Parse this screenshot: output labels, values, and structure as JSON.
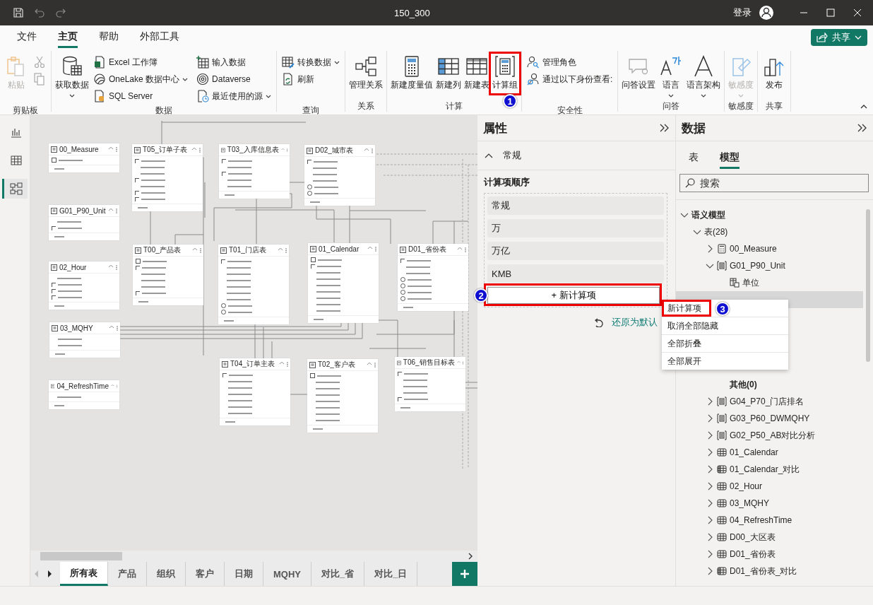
{
  "window": {
    "title": "150_300",
    "sign_in": "登录"
  },
  "menu_tabs": [
    {
      "label": "文件",
      "selected": false
    },
    {
      "label": "主页",
      "selected": true
    },
    {
      "label": "帮助",
      "selected": false
    },
    {
      "label": "外部工具",
      "selected": false
    }
  ],
  "share_button": "共享",
  "ribbon": [
    {
      "label": "剪贴板",
      "items": [
        {
          "kind": "big",
          "label": "粘贴",
          "disabled": true
        },
        {
          "kind": "icon",
          "disabled": true
        },
        {
          "kind": "icon",
          "disabled": true
        }
      ]
    },
    {
      "label": "数据",
      "items": [
        {
          "kind": "big",
          "label": "获取数据",
          "dropdown": true
        },
        {
          "kind": "small",
          "label": "Excel 工作簿"
        },
        {
          "kind": "small",
          "label": "OneLake 数据中心",
          "dropdown": true
        },
        {
          "kind": "small",
          "label": "SQL Server"
        },
        {
          "kind": "small",
          "label": "输入数据"
        },
        {
          "kind": "small",
          "label": "Dataverse"
        },
        {
          "kind": "small",
          "label": "最近使用的源",
          "dropdown": true
        }
      ]
    },
    {
      "label": "查询",
      "items": [
        {
          "kind": "small",
          "label": "转换数据",
          "dropdown": true
        },
        {
          "kind": "small",
          "label": "刷新"
        }
      ]
    },
    {
      "label": "关系",
      "items": [
        {
          "kind": "big",
          "label": "管理关系"
        }
      ]
    },
    {
      "label": "计算",
      "items": [
        {
          "kind": "big",
          "label": "新建度量值"
        },
        {
          "kind": "big",
          "label": "新建列"
        },
        {
          "kind": "big",
          "label": "新建表"
        },
        {
          "kind": "big",
          "label": "计算组",
          "highlighted": true,
          "step": "1"
        }
      ]
    },
    {
      "label": "安全性",
      "items": [
        {
          "kind": "small",
          "label": "管理角色"
        },
        {
          "kind": "small",
          "label": "通过以下身份查看:"
        }
      ]
    },
    {
      "label": "问答",
      "items": [
        {
          "kind": "big",
          "label": "问答设置"
        },
        {
          "kind": "big",
          "label": "语言",
          "dropdown": true
        },
        {
          "kind": "big",
          "label": "语言架构",
          "dropdown": true
        }
      ]
    },
    {
      "label": "敏感度",
      "items": [
        {
          "kind": "big",
          "label": "敏感度",
          "disabled": true,
          "dropdown": true
        }
      ]
    },
    {
      "label": "共享",
      "items": [
        {
          "kind": "big",
          "label": "发布"
        }
      ]
    }
  ],
  "rail": [
    {
      "selected": false
    },
    {
      "selected": false
    },
    {
      "selected": true
    }
  ],
  "diagram_tables": [
    {
      "title": "00_Measure",
      "fields": [
        {
          "kind": "calc"
        }
      ]
    },
    {
      "title": "T05_订单子表",
      "fields": [
        {
          "kind": "sum"
        },
        {
          "kind": "plain"
        },
        {
          "kind": "plain"
        },
        {
          "kind": "sum"
        },
        {
          "kind": "plain"
        },
        {
          "kind": "sum"
        },
        {
          "kind": "sum"
        }
      ]
    },
    {
      "title": "T03_入库信息表",
      "fields": [
        {
          "kind": "sum"
        },
        {
          "kind": "plain"
        },
        {
          "kind": "sum"
        },
        {
          "kind": "plain"
        },
        {
          "kind": "plain"
        }
      ]
    },
    {
      "title": "D02_城市表",
      "fields": [
        {
          "kind": "sum"
        },
        {
          "kind": "plain"
        },
        {
          "kind": "plain"
        },
        {
          "kind": "plain"
        },
        {
          "kind": "geo"
        },
        {
          "kind": "geo"
        }
      ]
    },
    {
      "title": "G01_P90_Unit",
      "fields": [
        {
          "kind": "plain"
        },
        {
          "kind": "sum"
        }
      ]
    },
    {
      "title": "02_Hour",
      "fields": [
        {
          "kind": "plain"
        },
        {
          "kind": "sum"
        },
        {
          "kind": "sum"
        },
        {
          "kind": "sum"
        }
      ]
    },
    {
      "title": "T00_产品表",
      "fields": [
        {
          "kind": "calc"
        },
        {
          "kind": "sum"
        },
        {
          "kind": "plain"
        },
        {
          "kind": "plain"
        },
        {
          "kind": "plain"
        },
        {
          "kind": "sum"
        }
      ]
    },
    {
      "title": "T01_门店表",
      "fields": [
        {
          "kind": "sum"
        },
        {
          "kind": "plain"
        },
        {
          "kind": "plain"
        },
        {
          "kind": "plain"
        },
        {
          "kind": "plain"
        },
        {
          "kind": "plain"
        },
        {
          "kind": "plain"
        },
        {
          "kind": "geo"
        },
        {
          "kind": "geo"
        }
      ]
    },
    {
      "title": "01_Calendar",
      "fields": [
        {
          "kind": "calc"
        },
        {
          "kind": "sum"
        },
        {
          "kind": "plain"
        },
        {
          "kind": "plain"
        },
        {
          "kind": "plain"
        },
        {
          "kind": "plain"
        },
        {
          "kind": "plain"
        },
        {
          "kind": "plain"
        },
        {
          "kind": "plain"
        }
      ]
    },
    {
      "title": "D01_省份表",
      "fields": [
        {
          "kind": "sum"
        },
        {
          "kind": "plain"
        },
        {
          "kind": "plain"
        },
        {
          "kind": "geo"
        },
        {
          "kind": "geo"
        },
        {
          "kind": "geo"
        },
        {
          "kind": "geo"
        }
      ]
    },
    {
      "title": "03_MQHY",
      "fields": [
        {
          "kind": "plain"
        },
        {
          "kind": "plain"
        }
      ]
    },
    {
      "title": "04_RefreshTime",
      "fields": [
        {
          "kind": "plain"
        }
      ]
    },
    {
      "title": "T04_订单主表",
      "fields": [
        {
          "kind": "sum"
        },
        {
          "kind": "plain"
        },
        {
          "kind": "plain"
        },
        {
          "kind": "plain"
        },
        {
          "kind": "plain"
        },
        {
          "kind": "plain"
        },
        {
          "kind": "plain"
        }
      ]
    },
    {
      "title": "T02_客户表",
      "fields": [
        {
          "kind": "calc"
        },
        {
          "kind": "plain"
        },
        {
          "kind": "plain"
        },
        {
          "kind": "plain"
        },
        {
          "kind": "plain"
        },
        {
          "kind": "plain"
        },
        {
          "kind": "plain"
        },
        {
          "kind": "plain"
        }
      ]
    },
    {
      "title": "T06_销售目标表",
      "fields": [
        {
          "kind": "sum"
        },
        {
          "kind": "plain"
        },
        {
          "kind": "plain"
        },
        {
          "kind": "plain"
        },
        {
          "kind": "sum"
        }
      ]
    }
  ],
  "layout_tabs": [
    {
      "label": "所有表",
      "selected": true
    },
    {
      "label": "产品",
      "selected": false
    },
    {
      "label": "组织",
      "selected": false
    },
    {
      "label": "客户",
      "selected": false
    },
    {
      "label": "日期",
      "selected": false
    },
    {
      "label": "MQHY",
      "selected": false
    },
    {
      "label": "对比_省",
      "selected": false
    },
    {
      "label": "对比_日",
      "selected": false
    }
  ],
  "properties": {
    "title": "属性",
    "section": "常规",
    "expanded": true,
    "order_label": "计算项顺序",
    "items": [
      "常规",
      "万",
      "万亿",
      "KMB"
    ],
    "add_button": "+ 新计算项",
    "add_step": "2",
    "reset_link": "还原为默认"
  },
  "data_pane": {
    "title": "数据",
    "tabs": [
      {
        "label": "表",
        "selected": false
      },
      {
        "label": "模型",
        "selected": true
      }
    ],
    "search": {
      "placeholder": "搜索"
    },
    "tree": [
      {
        "label": "语义模型",
        "kind": "root",
        "expanded": true,
        "children": [
          {
            "label": "表(28)",
            "expanded": true,
            "children": [
              {
                "label": "00_Measure",
                "kind": "measure",
                "expanded": false
              },
              {
                "label": "G01_P90_Unit",
                "kind": "calcgroup",
                "expanded": true,
                "children": [
                  {
                    "label": "单位",
                    "kind": "column"
                  },
                  {
                    "kind": "covered"
                  },
                  {
                    "label": "其他(0)",
                    "kind": "folder-bold"
                  }
                ]
              },
              {
                "label": "G04_P70_门店排名",
                "kind": "calcgroup",
                "expanded": false
              },
              {
                "label": "G03_P60_DWMQHY",
                "kind": "calcgroup",
                "expanded": false
              },
              {
                "label": "G02_P50_AB对比分析",
                "kind": "calcgroup",
                "expanded": false
              },
              {
                "label": "01_Calendar",
                "kind": "table",
                "expanded": false
              },
              {
                "label": "01_Calendar_对比",
                "kind": "calctable",
                "expanded": false
              },
              {
                "label": "02_Hour",
                "kind": "table",
                "expanded": false
              },
              {
                "label": "03_MQHY",
                "kind": "table",
                "expanded": false
              },
              {
                "label": "04_RefreshTime",
                "kind": "table",
                "expanded": false
              },
              {
                "label": "D00_大区表",
                "kind": "table",
                "expanded": false
              },
              {
                "label": "D01_省份表",
                "kind": "table",
                "expanded": false
              },
              {
                "label": "D01_省份表_对比",
                "kind": "calctable",
                "expanded": false
              }
            ]
          }
        ]
      }
    ]
  },
  "context_menu": {
    "items": [
      {
        "label": "新计算项",
        "highlighted": true,
        "step": "3"
      },
      {
        "label": "取消全部隐藏",
        "highlighted": false
      },
      {
        "label": "全部折叠",
        "highlighted": false
      },
      {
        "label": "全部展开",
        "highlighted": false
      }
    ]
  }
}
